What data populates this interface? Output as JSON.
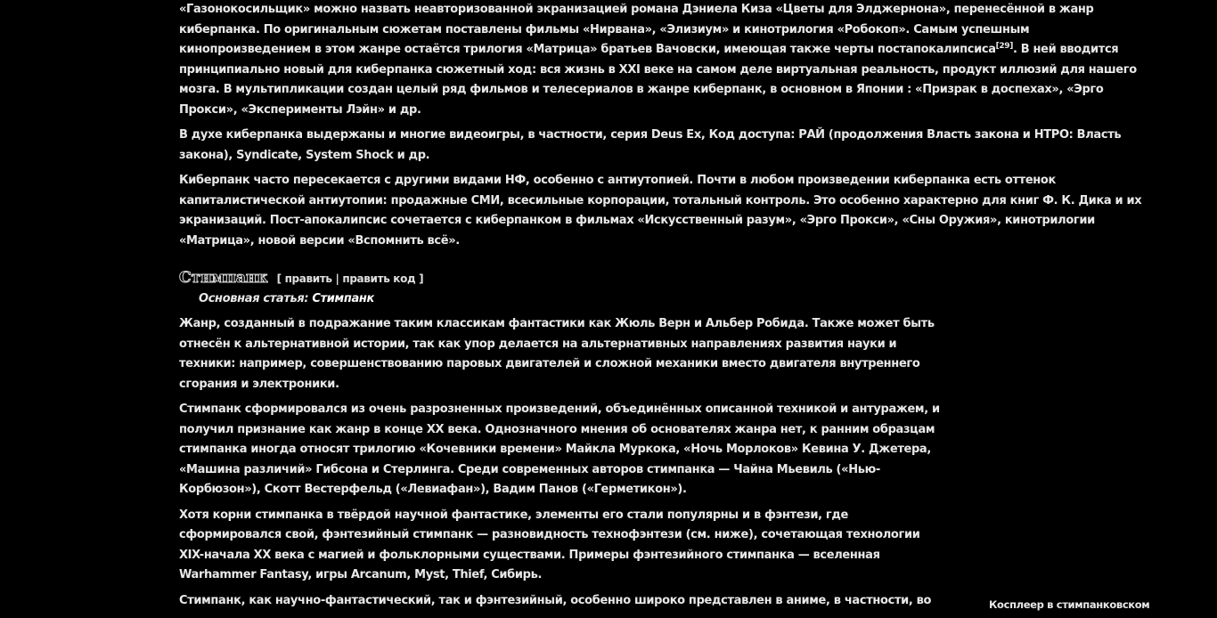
{
  "cyberpunk": {
    "p1_a": "«Газонокосильщик» можно назвать неавторизованной экранизацией романа Дэниела Киза «Цветы для Элджернона», перенесённой в жанр\nкиберпанка. По оригинальным сюжетам поставлены фильмы «Нирвана», «Элизиум» и кинотрилогия «Робокоп». Самым успешным\nкинопроизведением в этом жанре остаётся трилогия «Матрица» братьев Вачовски, имеющая также черты постапокалипсиса",
    "p1_ref": "[29]",
    "p1_b": ". В ней вводится\nпринципиально новый для киберпанка сюжетный ход: вся жизнь в XXI веке на самом деле виртуальная реальность, продукт иллюзий для нашего\nмозга. В мультипликации создан целый ряд фильмов и телесериалов в жанре киберпанк, в основном в Японии : «Призрак в доспехах», «Эрго\nПрокси», «Эксперименты Лэйн» и др.",
    "p2": "В духе киберпанка выдержаны и многие видеоигры, в частности, серия Deus Ex, Код доступа: РАЙ (продолжения Власть закона и НТРО: Власть\nзакона), Syndicate, System Shock и др.",
    "p3": "Киберпанк часто пересекается с другими видами НФ, особенно с антиутопией. Почти в любом произведении киберпанка есть оттенок\nкапиталистической антиутопии: продажные СМИ, всесильные корпорации, тотальный контроль. Это особенно характерно для книг Ф. К. Дика и их\nэкранизаций. Пост-апокалипсис сочетается с киберпанком в фильмах «Искусственный разум», «Эрго Прокси», «Сны Оружия», кинотрилогии\n«Матрица», новой версии «Вспомнить всё»."
  },
  "steampunk": {
    "heading": "Стимпанк",
    "edit_open": "[ ",
    "edit": "править",
    "edit_sep": " | ",
    "edit_code": "править код",
    "edit_close": " ]",
    "main_label": "Основная статья: ",
    "main_link": "Стимпанк",
    "p1": "Жанр, созданный в подражание таким классикам фантастики как Жюль Верн и Альбер Робида. Также может быть\nотнесён к альтернативной истории, так как упор делается на альтернативных направлениях развития науки и\nтехники: например, совершенствованию паровых двигателей и сложной механики вместо двигателя внутреннего\nсгорания и электроники.",
    "p2": "Стимпанк сформировался из очень разрозненных произведений, объединённых описанной техникой и антуражем, и\nполучил признание как жанр в конце XX века. Однозначного мнения об основателях жанра нет, к ранним образцам\nстимпанка иногда относят трилогию «Кочевники времени» Майкла Муркока, «Ночь Морлоков» Кевина У. Джетера,\n«Машина различий» Гибсона и Стерлинга. Среди современных авторов стимпанка — Чайна Мьевиль («Нью-\nКорбюзон»), Скотт Вестерфельд («Левиафан»), Вадим Панов («Герметикон»).",
    "p3": "Хотя корни стимпанка в твёрдой научной фантастике, элементы его стали популярны и в фэнтези, где\nсформировался свой, фэнтезийный стимпанк — разновидность технофэнтези (см. ниже), сочетающая технологии\nXIX-начала XX века с магией и фольклорными существами. Примеры фэнтезийного стимпанка — вселенная\nWarhammer Fantasy, игры Arcanum, Myst, Thief, Сибирь.",
    "p4": "Стимпанк, как научно-фантастический, так и фэнтезийный, особенно широко представлен в аниме, в частности, во",
    "thumb_caption": "Косплеер в стимпанковском"
  }
}
